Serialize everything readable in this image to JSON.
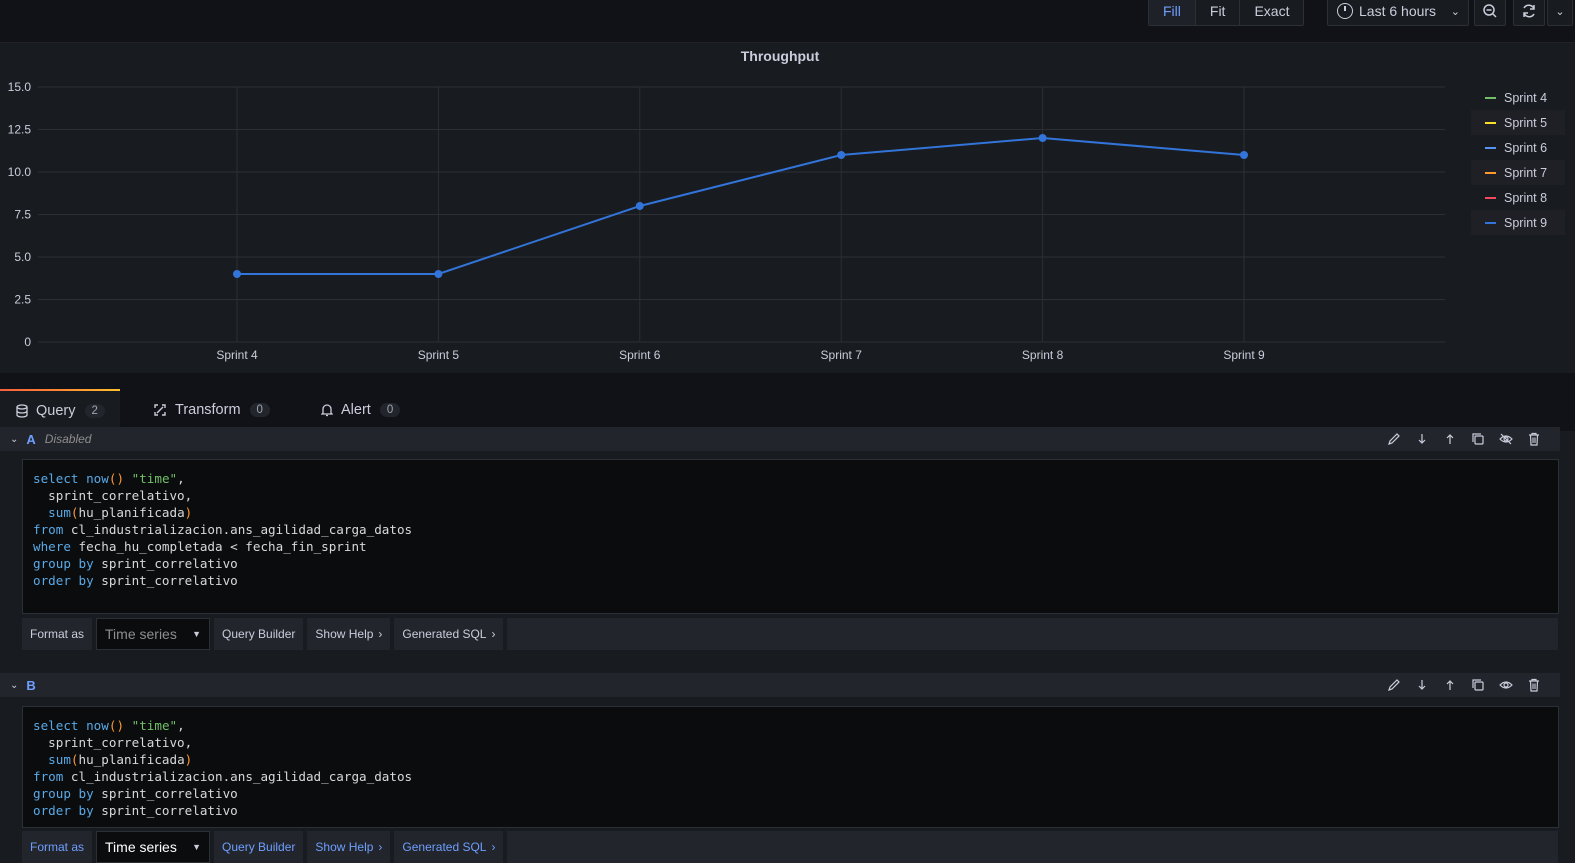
{
  "toolbar": {
    "fill_label": "Fill",
    "fit_label": "Fit",
    "exact_label": "Exact",
    "time_range": "Last 6 hours",
    "icons": [
      "clock-icon",
      "zoom-out-icon",
      "refresh-icon",
      "chevron-down-icon"
    ]
  },
  "panel": {
    "title": "Throughput"
  },
  "chart_data": {
    "type": "line",
    "title": "Throughput",
    "categories": [
      "Sprint 4",
      "Sprint 5",
      "Sprint 6",
      "Sprint 7",
      "Sprint 8",
      "Sprint 9"
    ],
    "series": [
      {
        "values": [
          4,
          4,
          8,
          11,
          12,
          11
        ],
        "color": "#3274d9"
      }
    ],
    "ylim": [
      0,
      15
    ],
    "yticks": [
      "0",
      "2.5",
      "5.0",
      "7.5",
      "10.0",
      "12.5",
      "15.0"
    ],
    "grid": true,
    "legend": {
      "placement": "right",
      "entries": [
        {
          "name": "Sprint 4",
          "color": "#73bf69"
        },
        {
          "name": "Sprint 5",
          "color": "#fade2a"
        },
        {
          "name": "Sprint 6",
          "color": "#5794f2"
        },
        {
          "name": "Sprint 7",
          "color": "#ff9830"
        },
        {
          "name": "Sprint 8",
          "color": "#f2495c"
        },
        {
          "name": "Sprint 9",
          "color": "#3274d9"
        }
      ]
    }
  },
  "tabs": [
    {
      "label": "Query",
      "count": "2",
      "icon": "database-icon"
    },
    {
      "label": "Transform",
      "count": "0",
      "icon": "transform-icon"
    },
    {
      "label": "Alert",
      "count": "0",
      "icon": "bell-icon"
    }
  ],
  "queries": {
    "a": {
      "letter": "A",
      "state": "Disabled",
      "sql": [
        "select now() \"time\",",
        "  sprint_correlativo,",
        "  sum(hu_planificada)",
        "from cl_industrializacion.ans_agilidad_carga_datos",
        "where fecha_hu_completada < fecha_fin_sprint",
        "group by sprint_correlativo",
        "order by sprint_correlativo"
      ],
      "format_label": "Format as",
      "format_value": "Time series",
      "query_builder": "Query Builder",
      "show_help": "Show Help",
      "generated_sql": "Generated SQL"
    },
    "b": {
      "letter": "B",
      "sql": [
        "select now() \"time\",",
        "  sprint_correlativo,",
        "  sum(hu_planificada)",
        "from cl_industrializacion.ans_agilidad_carga_datos",
        "group by sprint_correlativo",
        "order by sprint_correlativo"
      ],
      "format_label": "Format as",
      "format_value": "Time series",
      "query_builder": "Query Builder",
      "show_help": "Show Help",
      "generated_sql": "Generated SQL"
    }
  }
}
